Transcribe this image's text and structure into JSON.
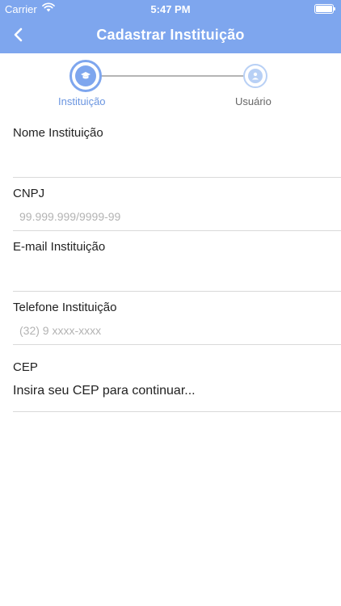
{
  "status": {
    "carrier": "Carrier",
    "time": "5:47 PM"
  },
  "nav": {
    "title": "Cadastrar Instituição"
  },
  "stepper": {
    "steps": [
      {
        "label": "Instituição",
        "icon": "graduation-cap-icon",
        "active": true
      },
      {
        "label": "Usuário",
        "icon": "user-icon",
        "active": false
      }
    ]
  },
  "form": {
    "nome": {
      "label": "Nome Instituição",
      "placeholder": ""
    },
    "cnpj": {
      "label": "CNPJ",
      "placeholder": "99.999.999/9999-99"
    },
    "email": {
      "label": "E-mail Instituição",
      "placeholder": ""
    },
    "telefone": {
      "label": "Telefone Instituição",
      "placeholder": "(32) 9 xxxx-xxxx"
    },
    "cep": {
      "label": "CEP",
      "value": "Insira seu CEP para continuar..."
    }
  },
  "colors": {
    "accent": "#7ea6ee",
    "accent_light": "#b8d0f5",
    "separator": "#d9d9d9"
  }
}
